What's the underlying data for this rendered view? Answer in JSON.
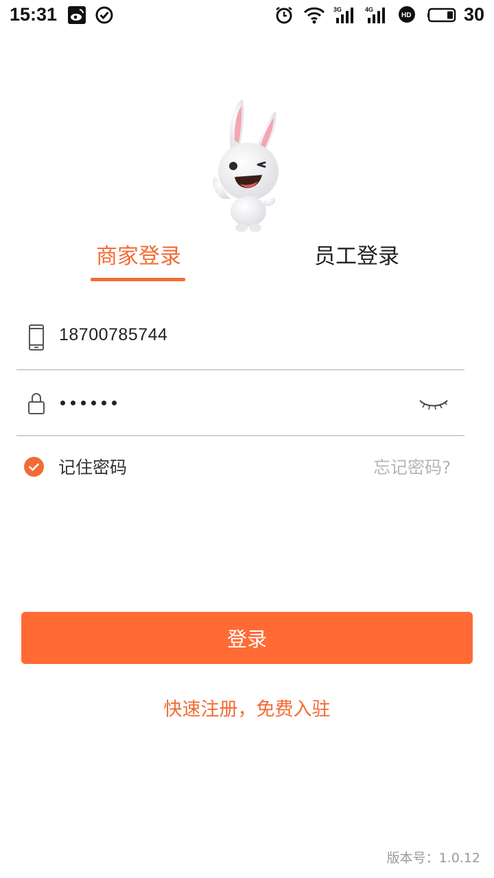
{
  "status_bar": {
    "time": "15:31",
    "icons": [
      "weibo-icon",
      "check-circle-icon",
      "alarm-icon",
      "wifi-icon",
      "signal-3g-icon",
      "signal-4g-icon",
      "hd-icon",
      "battery-icon"
    ],
    "net1": "3G",
    "net2": "4G",
    "hd": "HD",
    "battery": "30"
  },
  "tabs": [
    {
      "label": "商家登录",
      "active": true
    },
    {
      "label": "员工登录",
      "active": false
    }
  ],
  "form": {
    "phone_value": "18700785744",
    "password_masked_length": 6
  },
  "remember": {
    "label": "记住密码",
    "checked": true
  },
  "forgot": {
    "label": "忘记密码?"
  },
  "login_button": {
    "label": "登录"
  },
  "register": {
    "label": "快速注册，免费入驻"
  },
  "version": {
    "label": "版本号：1.0.12"
  },
  "colors": {
    "accent": "#ff6a35",
    "text": "#222222",
    "muted": "#b5b5b5",
    "divider": "#cfcfcf"
  }
}
